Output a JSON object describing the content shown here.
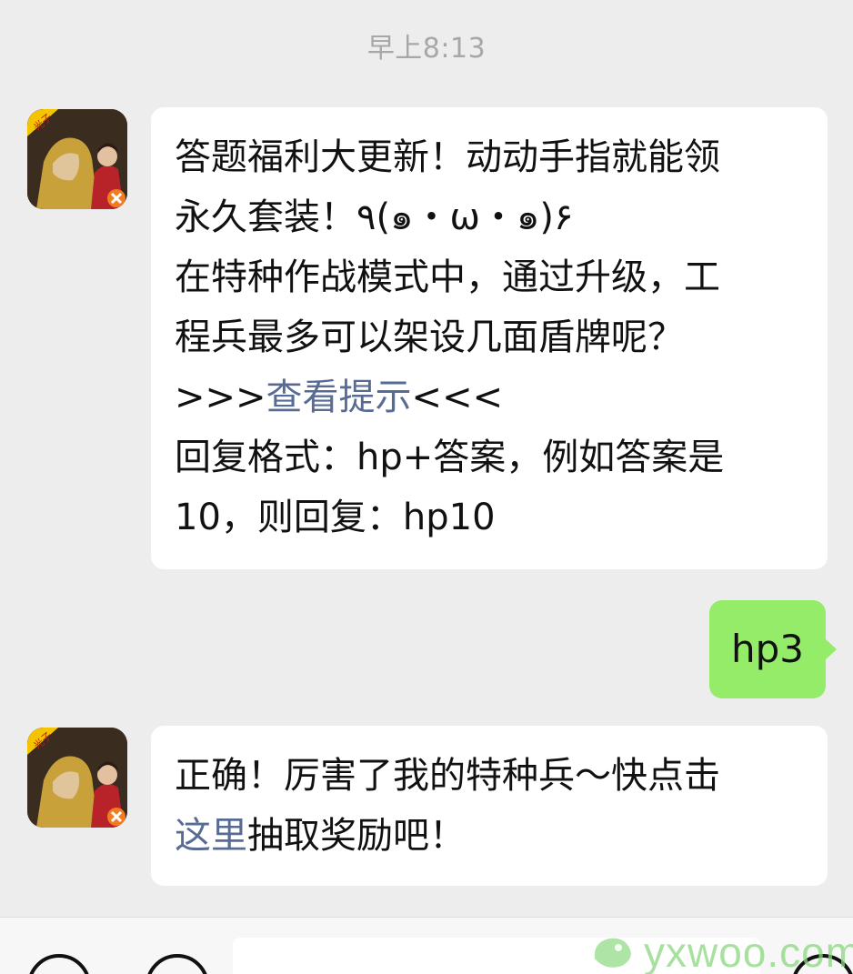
{
  "timestamp": "早上8:13",
  "messages": [
    {
      "sender": "official-account",
      "avatar_badge": "光子",
      "lines": [
        "答题福利大更新！动动手指就能领",
        "永久套装！٩(๑・ω・๑)۶",
        "在特种作战模式中，通过升级，工",
        "程兵最多可以架设几面盾牌呢？"
      ],
      "hint_prefix": ">>>",
      "hint_link": "查看提示",
      "hint_suffix": "<<<",
      "format_lines": [
        "回复格式：hp+答案，例如答案是",
        "10，则回复：hp10"
      ]
    },
    {
      "sender": "me",
      "text": "hp3"
    },
    {
      "sender": "official-account",
      "avatar_badge": "光子",
      "line1": "正确！厉害了我的特种兵～快点击",
      "link": "这里",
      "line2_rest": "抽取奖励吧！"
    }
  ],
  "watermark": "yxwoo.com",
  "icons": [
    "voice-icon",
    "emoji-icon",
    "plus-icon"
  ],
  "colors": {
    "background": "#ededed",
    "bubble_in": "#ffffff",
    "bubble_out": "#95ec69",
    "link": "#576b95"
  }
}
